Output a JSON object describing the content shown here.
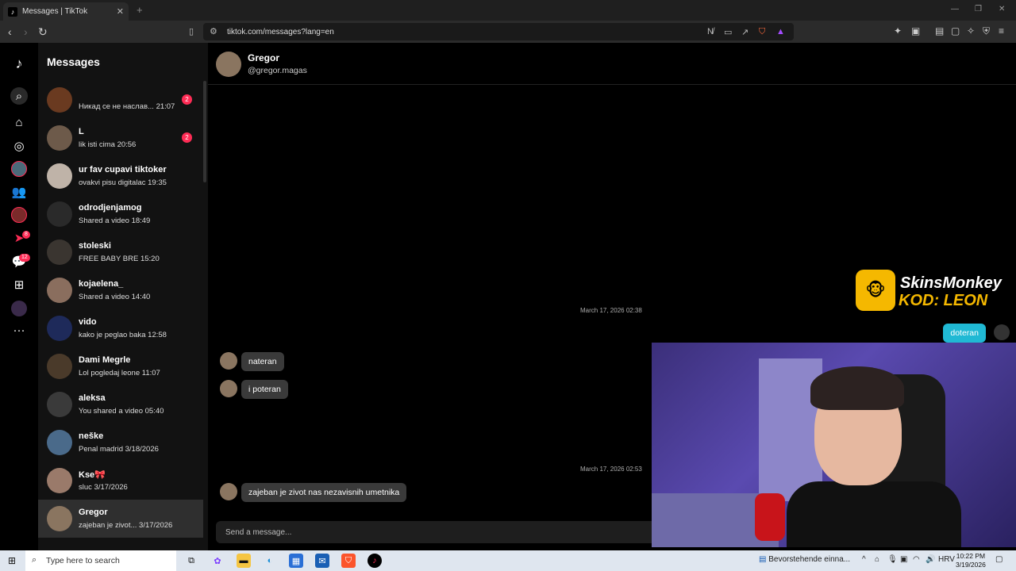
{
  "browser": {
    "tab_title": "Messages | TikTok",
    "url": "tiktok.com/messages?lang=en"
  },
  "rail": {
    "badges": {
      "inbox": "8",
      "messages": "12"
    }
  },
  "sidebar": {
    "title": "Messages",
    "conversations": [
      {
        "name": "",
        "preview": "Никад се не наслав...",
        "time": "21:07",
        "badge": "2"
      },
      {
        "name": "L",
        "preview": "lik isti cima",
        "time": "20:56",
        "badge": "2"
      },
      {
        "name": "ur fav cupavi tiktoker",
        "preview": "ovakvi pisu digitalac",
        "time": "19:35",
        "badge": ""
      },
      {
        "name": "odrodjenjamog",
        "preview": "Shared a video",
        "time": "18:49",
        "badge": ""
      },
      {
        "name": "stoleski",
        "preview": "FREE BABY BRE",
        "time": "15:20",
        "badge": ""
      },
      {
        "name": "kojaelena_",
        "preview": "Shared a video",
        "time": "14:40",
        "badge": ""
      },
      {
        "name": "vido",
        "preview": "kako je peglao baka",
        "time": "12:58",
        "badge": ""
      },
      {
        "name": "Dami Megrle",
        "preview": "Lol pogledaj leone",
        "time": "11:07",
        "badge": ""
      },
      {
        "name": "aleksa",
        "preview": "You shared a video",
        "time": "05:40",
        "badge": ""
      },
      {
        "name": "neške",
        "preview": "Penal madrid",
        "time": "3/18/2026",
        "badge": ""
      },
      {
        "name": "Kse🎀",
        "preview": "sluc",
        "time": "3/17/2026",
        "badge": ""
      },
      {
        "name": "Gregor",
        "preview": "zajeban je zivot...",
        "time": "3/17/2026",
        "badge": ""
      }
    ]
  },
  "chat": {
    "name": "Gregor",
    "username": "@gregor.magas",
    "timestamp1": "March 17, 2026 02:38",
    "timestamp2": "March 17, 2026 02:53",
    "messages": {
      "out1": "doteran",
      "in1": "nateran",
      "in2": "i poteran",
      "in3": "zajeban je zivot nas nezavisnih umetnika"
    },
    "input_placeholder": "Send a message..."
  },
  "overlay": {
    "sponsor_line1": "SkinsMonkey",
    "sponsor_line2": "KOD: LEON"
  },
  "taskbar": {
    "search_placeholder": "Type here to search",
    "notification": "Bevorstehende einna...",
    "language": "HRV",
    "time": "10:22 PM",
    "date": "3/19/2026"
  },
  "colors": {
    "accent_pink": "#fe2c55",
    "outgoing_bubble": "#20b9d4",
    "sponsor_yellow": "#f5b800"
  }
}
